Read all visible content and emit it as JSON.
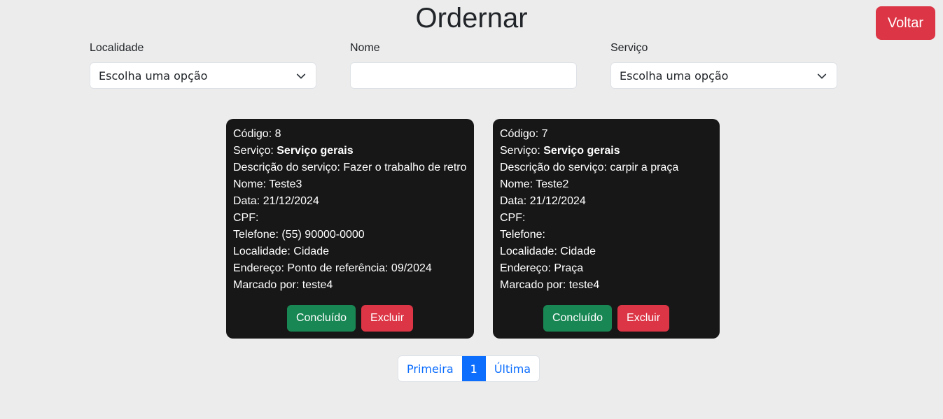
{
  "header": {
    "title": "Ordernar",
    "back_label": "Voltar"
  },
  "filters": {
    "localidade": {
      "label": "Localidade",
      "value": "Escolha uma opção"
    },
    "nome": {
      "label": "Nome",
      "value": ""
    },
    "servico": {
      "label": "Serviço",
      "value": "Escolha uma opção"
    }
  },
  "cards": [
    {
      "codigo_label": "Código:",
      "codigo": "8",
      "servico_label": "Serviço:",
      "servico": "Serviço gerais",
      "descricao_label": "Descrição do serviço:",
      "descricao": "Fazer o trabalho de retro",
      "nome_label": "Nome:",
      "nome": "Teste3",
      "data_label": "Data:",
      "data": "21/12/2024",
      "cpf_label": "CPF:",
      "cpf": "",
      "telefone_label": "Telefone:",
      "telefone": "(55) 90000-0000",
      "localidade_label": "Localidade:",
      "localidade": "Cidade",
      "endereco_label": "Endereço:",
      "endereco": "Ponto de referência: 09/2024",
      "marcado_label": "Marcado por:",
      "marcado": "teste4",
      "done_label": "Concluído",
      "delete_label": "Excluir"
    },
    {
      "codigo_label": "Código:",
      "codigo": "7",
      "servico_label": "Serviço:",
      "servico": "Serviço gerais",
      "descricao_label": "Descrição do serviço:",
      "descricao": "carpir a praça",
      "nome_label": "Nome:",
      "nome": "Teste2",
      "data_label": "Data:",
      "data": "21/12/2024",
      "cpf_label": "CPF:",
      "cpf": "",
      "telefone_label": "Telefone:",
      "telefone": "",
      "localidade_label": "Localidade:",
      "localidade": "Cidade",
      "endereco_label": "Endereço:",
      "endereco": "Praça",
      "marcado_label": "Marcado por:",
      "marcado": "teste4",
      "done_label": "Concluído",
      "delete_label": "Excluir"
    }
  ],
  "pagination": {
    "first": "Primeira",
    "current": "1",
    "last": "Última"
  },
  "icons": {
    "select_chevron": "chevron-down-icon"
  },
  "colors": {
    "danger": "#dc3545",
    "success": "#198754",
    "primary": "#0d6efd",
    "card_bg": "#171717"
  }
}
